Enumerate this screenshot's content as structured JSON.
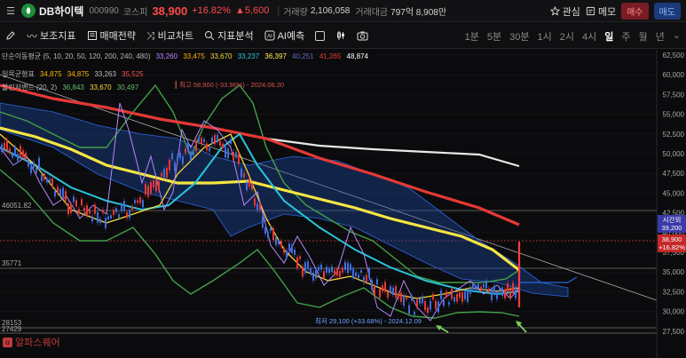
{
  "header": {
    "stock_name": "DB하이텍",
    "stock_code": "000990",
    "market": "코스피",
    "price": "38,900",
    "change_pct": "+16.82%",
    "change": "▲5,600",
    "volume_label": "거래량",
    "volume": "2,106,058",
    "amount_label": "거래대금",
    "amount": "797억 8,908만",
    "watch_label": "관심",
    "memo_label": "메모",
    "buy_label": "매수",
    "sell_label": "매도"
  },
  "toolbar": {
    "items": [
      "보조지표",
      "매매전략",
      "비교차트",
      "지표분석",
      "AI예측"
    ],
    "periods": [
      "1분",
      "5분",
      "30분",
      "1시",
      "2시",
      "4시",
      "일",
      "주",
      "월",
      "년"
    ],
    "active_period": "일"
  },
  "legends": {
    "ma": {
      "name": "단순이동평균 (5, 10, 20, 50, 120, 200, 240, 480)",
      "values": [
        "33,260",
        "33,475",
        "33,670",
        "33,237",
        "36,397",
        "40,251",
        "41,265",
        "48,874"
      ],
      "colors": [
        "#b388ff",
        "#ffb300",
        "#fdd835",
        "#26c6da",
        "#ffee58",
        "#5c6bc0",
        "#e53935",
        "#ffffff"
      ]
    },
    "ichimoku": {
      "name": "일목균형표",
      "values": [
        "34,875",
        "34,875",
        "33,263",
        "35,525"
      ],
      "colors": [
        "#ffb300",
        "#ffb300",
        "#bdbdbd",
        "#ef5350"
      ]
    },
    "bollinger": {
      "name": "볼린저밴드 (20, 2)",
      "values": [
        "36,843",
        "33,670",
        "30,497"
      ],
      "colors": [
        "#66bb6a",
        "#fdd835",
        "#66bb6a"
      ]
    }
  },
  "annotations": {
    "high": "최고 58,900 (-33.96%) - 2024.06.20",
    "low": "최저 29,100 (+33.68%) - 2024.12.09"
  },
  "levels": {
    "l1": "46051.82",
    "l2": "35771",
    "l3": "28153",
    "l4": "27429"
  },
  "badges": {
    "timer_label": "시간외",
    "timer_value": "39,200",
    "current": "38,900",
    "current_pct": "+16.82%"
  },
  "chart_data": {
    "type": "line",
    "y_axis": {
      "ticks": [
        "62,500",
        "60,000",
        "57,500",
        "55,000",
        "52,500",
        "50,000",
        "47,500",
        "45,000",
        "42,500",
        "40,000",
        "37,500",
        "35,000",
        "32,500",
        "30,000",
        "27,500"
      ],
      "min": 27500,
      "max": 62500
    },
    "series": [
      {
        "name": "480",
        "color": "#f0f0f0",
        "values": [
          57000,
          56000,
          54500,
          53200,
          52200,
          51500,
          51000,
          50500,
          50200,
          49800,
          49400,
          48900
        ]
      },
      {
        "name": "240",
        "color": "#e53935",
        "values": [
          53500,
          52800,
          52200,
          51500,
          50500,
          49500,
          48500,
          47500,
          46000,
          44500,
          42800,
          41300
        ]
      },
      {
        "name": "120",
        "color": "#ffee58",
        "values": [
          53000,
          51000,
          48500,
          46000,
          46500,
          47000,
          46500,
          45000,
          43500,
          42500,
          40500,
          36400
        ]
      },
      {
        "name": "50",
        "color": "#26c6da",
        "values": [
          49000,
          45500,
          42500,
          44000,
          47500,
          48500,
          46000,
          42000,
          38000,
          35500,
          34000,
          33237
        ]
      }
    ]
  },
  "watermark": "알파스퀘어"
}
